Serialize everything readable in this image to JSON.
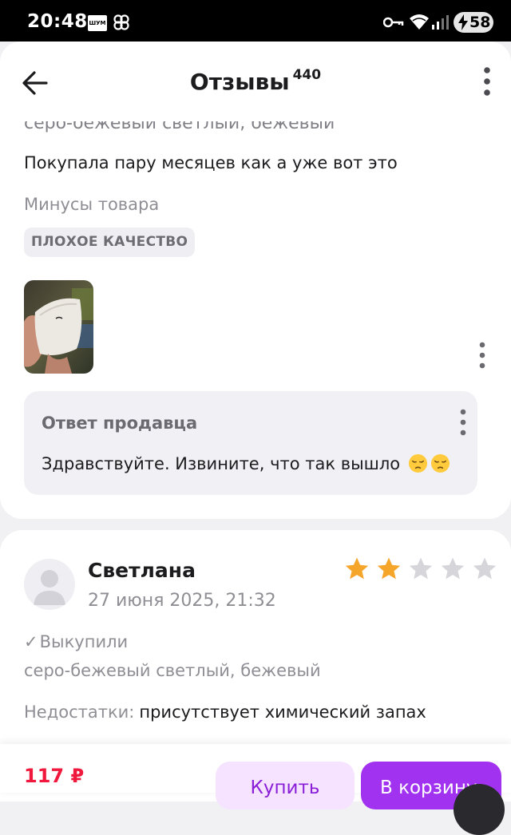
{
  "status_bar": {
    "time": "20:48",
    "app_badge": "ШУМ",
    "battery": "58"
  },
  "header": {
    "title": "Отзывы",
    "count": "440"
  },
  "review1": {
    "variant": "серо-бежевый светлый, бежевый",
    "text": "Покупала пару месяцев как а уже вот это",
    "cons_label": "Минусы товара",
    "cons_tag": "ПЛОХОЕ КАЧЕСТВО",
    "seller_reply": {
      "label": "Ответ продавца",
      "text": "Здравствуйте. Извините, что так вышло"
    }
  },
  "review2": {
    "author": "Светлана",
    "date": "27 июня 2025, 21:32",
    "rating": 2,
    "rating_max": 5,
    "bought": "Выкупили",
    "variant": "серо-бежевый светлый, бежевый",
    "cons_label": "Недостатки:",
    "cons_text": "присутствует химический запах"
  },
  "bottom_bar": {
    "price": "117 ₽",
    "buy_label": "Купить",
    "cart_label": "В корзину"
  },
  "colors": {
    "star_filled": "#f6a52b",
    "star_empty": "#d5d5da",
    "price": "#f0193d",
    "accent": "#a032f0"
  }
}
